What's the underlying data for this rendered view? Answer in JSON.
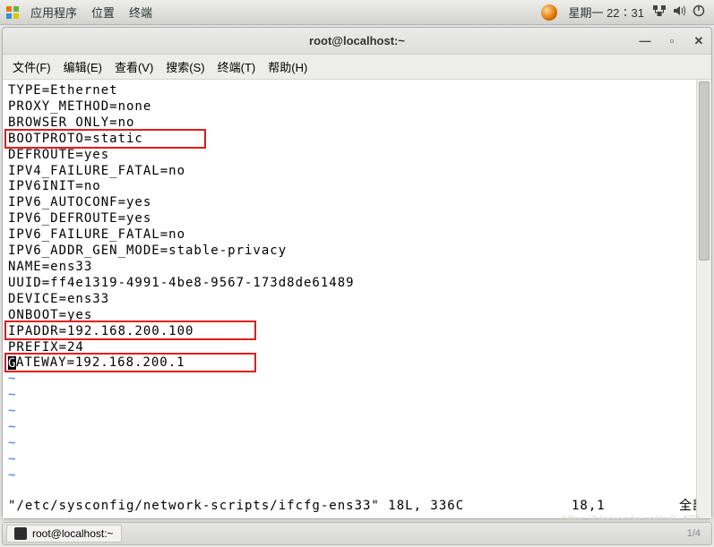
{
  "panel": {
    "apps": "应用程序",
    "places": "位置",
    "terminal": "终端",
    "clock": "星期一 22∶31"
  },
  "window": {
    "title": "root@localhost:~",
    "menus": {
      "file": "文件(F)",
      "edit": "编辑(E)",
      "view": "查看(V)",
      "search": "搜索(S)",
      "terminal": "终端(T)",
      "help": "帮助(H)"
    }
  },
  "content": {
    "lines": [
      "TYPE=Ethernet",
      "PROXY_METHOD=none",
      "BROWSER_ONLY=no",
      "BOOTPROTO=static",
      "DEFROUTE=yes",
      "IPV4_FAILURE_FATAL=no",
      "IPV6INIT=no",
      "IPV6_AUTOCONF=yes",
      "IPV6_DEFROUTE=yes",
      "IPV6_FAILURE_FATAL=no",
      "IPV6_ADDR_GEN_MODE=stable-privacy",
      "NAME=ens33",
      "UUID=ff4e1319-4991-4be8-9567-173d8de61489",
      "DEVICE=ens33",
      "ONBOOT=yes",
      "IPADDR=192.168.200.100",
      "PREFIX=24",
      "GATEWAY=192.168.200.1"
    ],
    "tilde": "~",
    "status_path": "\"/etc/sysconfig/network-scripts/ifcfg-ens33\" 18L, 336C",
    "status_pos": "18,1",
    "status_all": "全部"
  },
  "taskbar": {
    "item": "root@localhost:~",
    "right": "1/4"
  },
  "watermark": "https://blog.csdn.net/m0_472..."
}
